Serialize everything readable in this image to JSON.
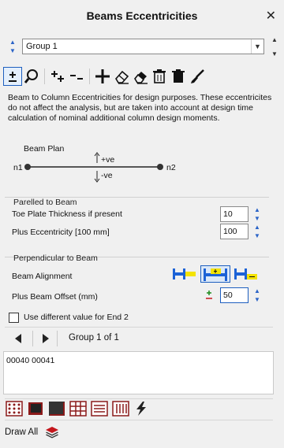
{
  "window": {
    "title": "Beams Eccentricities"
  },
  "group_select": {
    "value": "Group 1"
  },
  "toolbar_icons": [
    "plus-minus-icon",
    "search-icon",
    "add-multiple-icon",
    "remove-multiple-icon",
    "add-icon",
    "eraser-icon",
    "eraser-filled-icon",
    "trash-outline-icon",
    "trash-filled-icon",
    "brush-icon"
  ],
  "description": "Beam to Column Eccentricities for design purposes. These eccentricites do not affect the analysis, but are taken into account at design time calculation of nominal additional column design moments.",
  "beam_plan": {
    "title": "Beam Plan",
    "node_start": "n1",
    "node_end": "n2",
    "positive": "+ve",
    "negative": "-ve"
  },
  "parallel": {
    "title": "Parelled to Beam",
    "toe_plate_label": "Toe Plate Thickness if present",
    "toe_plate_value": "10",
    "plus_ecc_label": "Plus Eccentricity [100 mm]",
    "plus_ecc_value": "100"
  },
  "perpendicular": {
    "title": "Perpendicular to Beam",
    "alignment_label": "Beam Alignment",
    "offset_label": "Plus Beam Offset (mm)",
    "offset_value": "50",
    "colors": {
      "blue": "#1c62d6",
      "yellow": "#f4e300"
    }
  },
  "end2_checkbox": {
    "label": "Use different value for End 2"
  },
  "navigation": {
    "group_label": "Group 1 of 1"
  },
  "list": {
    "items": [
      "00040 00041"
    ]
  },
  "bottom_icons": [
    "grid-dots-icon",
    "frame-icon",
    "fill-square-icon",
    "hash-grid-icon",
    "horizontal-lines-icon",
    "vertical-lines-icon",
    "lightning-icon"
  ],
  "draw_all": {
    "label": "Draw All"
  },
  "colors": {
    "accent": "#1e5fbf",
    "red": "#c4161c"
  }
}
